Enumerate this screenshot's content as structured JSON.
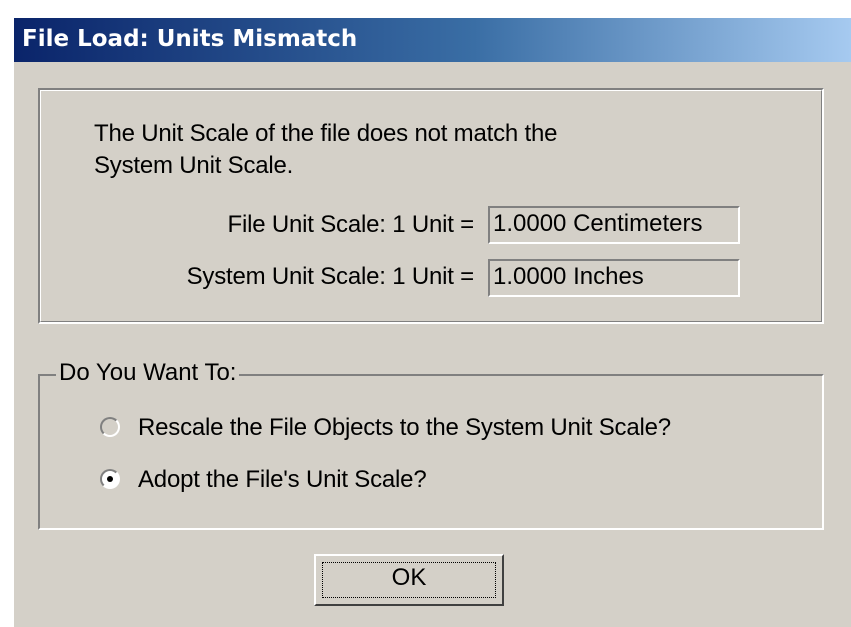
{
  "window": {
    "title": "File Load: Units Mismatch"
  },
  "message": {
    "line1": "The Unit Scale of the file does not match the",
    "line2": "System Unit Scale."
  },
  "file_scale": {
    "label": "File Unit Scale: 1 Unit =",
    "value": "1.0000 Centimeters"
  },
  "system_scale": {
    "label": "System Unit Scale: 1 Unit =",
    "value": "1.0000 Inches"
  },
  "choice_group": {
    "legend": "Do You Want To:",
    "options": [
      {
        "label": "Rescale the File Objects to the System Unit Scale?",
        "selected": false
      },
      {
        "label": "Adopt the File's Unit Scale?",
        "selected": true
      }
    ]
  },
  "buttons": {
    "ok": "OK"
  },
  "colors": {
    "dialog_face": "#d4d0c8",
    "title_start": "#0a246a",
    "title_end": "#a6caf0"
  }
}
